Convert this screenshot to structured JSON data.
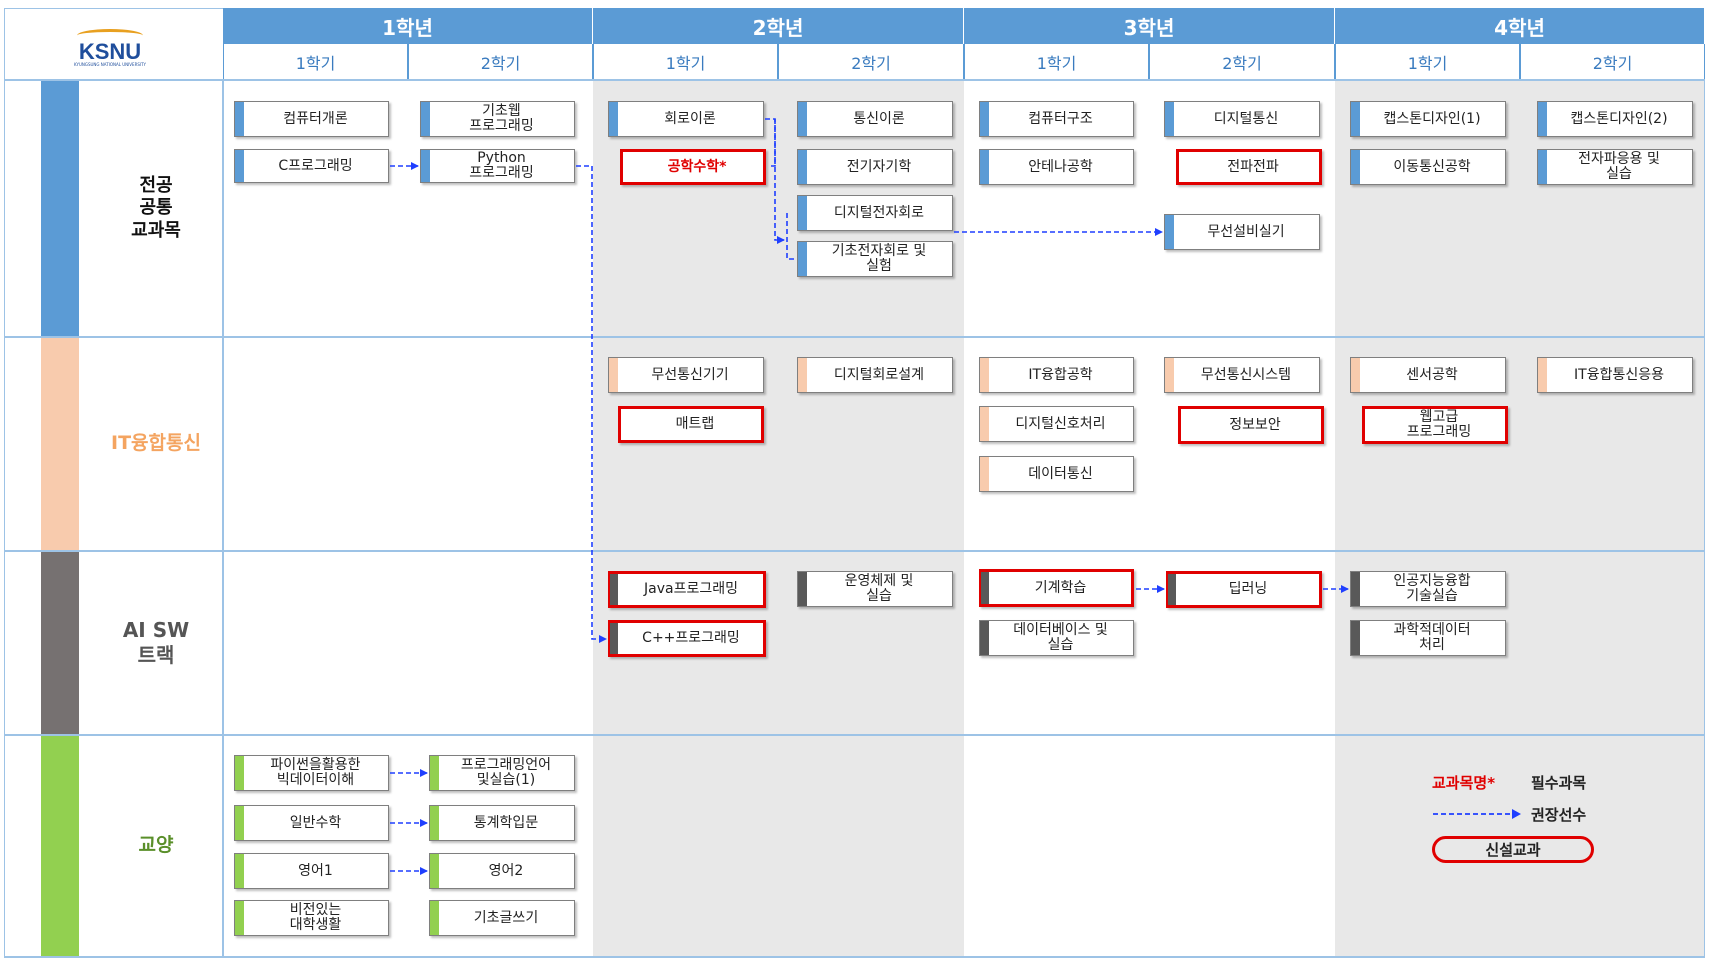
{
  "logo": {
    "text": "KSNU",
    "subtext": "KYUNGSUNG NATIONAL UNIVERSITY"
  },
  "years": [
    "1학년",
    "2학년",
    "3학년",
    "4학년"
  ],
  "semesters": [
    "1학기",
    "2학기",
    "1학기",
    "2학기",
    "1학기",
    "2학기",
    "1학기",
    "2학기"
  ],
  "categories": [
    {
      "label": "전공\n공통\n교과목",
      "color": "#5b9bd5",
      "text_color": "#111111"
    },
    {
      "label": "IT융합통신",
      "color": "#f8cbad",
      "text_color": "#f4a460"
    },
    {
      "label": "AI  SW\n트랙",
      "color": "#767171",
      "text_color": "#555555"
    },
    {
      "label": "교양",
      "color": "#92d050",
      "text_color": "#5a8f2a"
    }
  ],
  "courses": {
    "c1": "컴퓨터개론",
    "c2": "C프로그래밍",
    "c3": "기초웹\n프로그래밍",
    "c4": "Python\n프로그래밍",
    "c5": "회로이론",
    "c6": "공학수학*",
    "c7": "통신이론",
    "c8": "전기자기학",
    "c9": "디지털전자회로",
    "c10": "기초전자회로 및\n실험",
    "c11": "컴퓨터구조",
    "c12": "안테나공학",
    "c13": "디지털통신",
    "c14": "전파전파",
    "c15": "무선설비실기",
    "c16": "캡스톤디자인(1)",
    "c17": "이동통신공학",
    "c18": "캡스톤디자인(2)",
    "c19": "전자파응용 및\n실습",
    "i1": "무선통신기기",
    "i2": "매트랩",
    "i3": "디지털회로설계",
    "i4": "IT융합공학",
    "i5": "디지털신호처리",
    "i6": "데이터통신",
    "i7": "무선통신시스템",
    "i8": "정보보안",
    "i9": "센서공학",
    "i10": "웹고급\n프로그래밍",
    "i11": "IT융합통신응용",
    "a1": "Java프로그래밍",
    "a2": "C++프로그래밍",
    "a3": "운영체제 및\n실습",
    "a4": "기계학습",
    "a5": "데이터베이스 및\n실습",
    "a6": "딥러닝",
    "a7": "인공지능융합\n기술실습",
    "a8": "과학적데이터\n처리",
    "g1": "파이썬을활용한\n빅데이터이해",
    "g2": "프로그래밍언어\n및실습(1)",
    "g3": "일반수학",
    "g4": "통계학입문",
    "g5": "영어1",
    "g6": "영어2",
    "g7": "비전있는\n대학생활",
    "g8": "기초글쓰기"
  },
  "legend": {
    "sample_name": "교과목명*",
    "required": "필수과목",
    "recommended": "권장선수",
    "new_course": "신설교과"
  },
  "colors": {
    "header_blue": "#5b9bd5",
    "required_red": "#e00000",
    "arrow_blue": "#1f3fff"
  }
}
